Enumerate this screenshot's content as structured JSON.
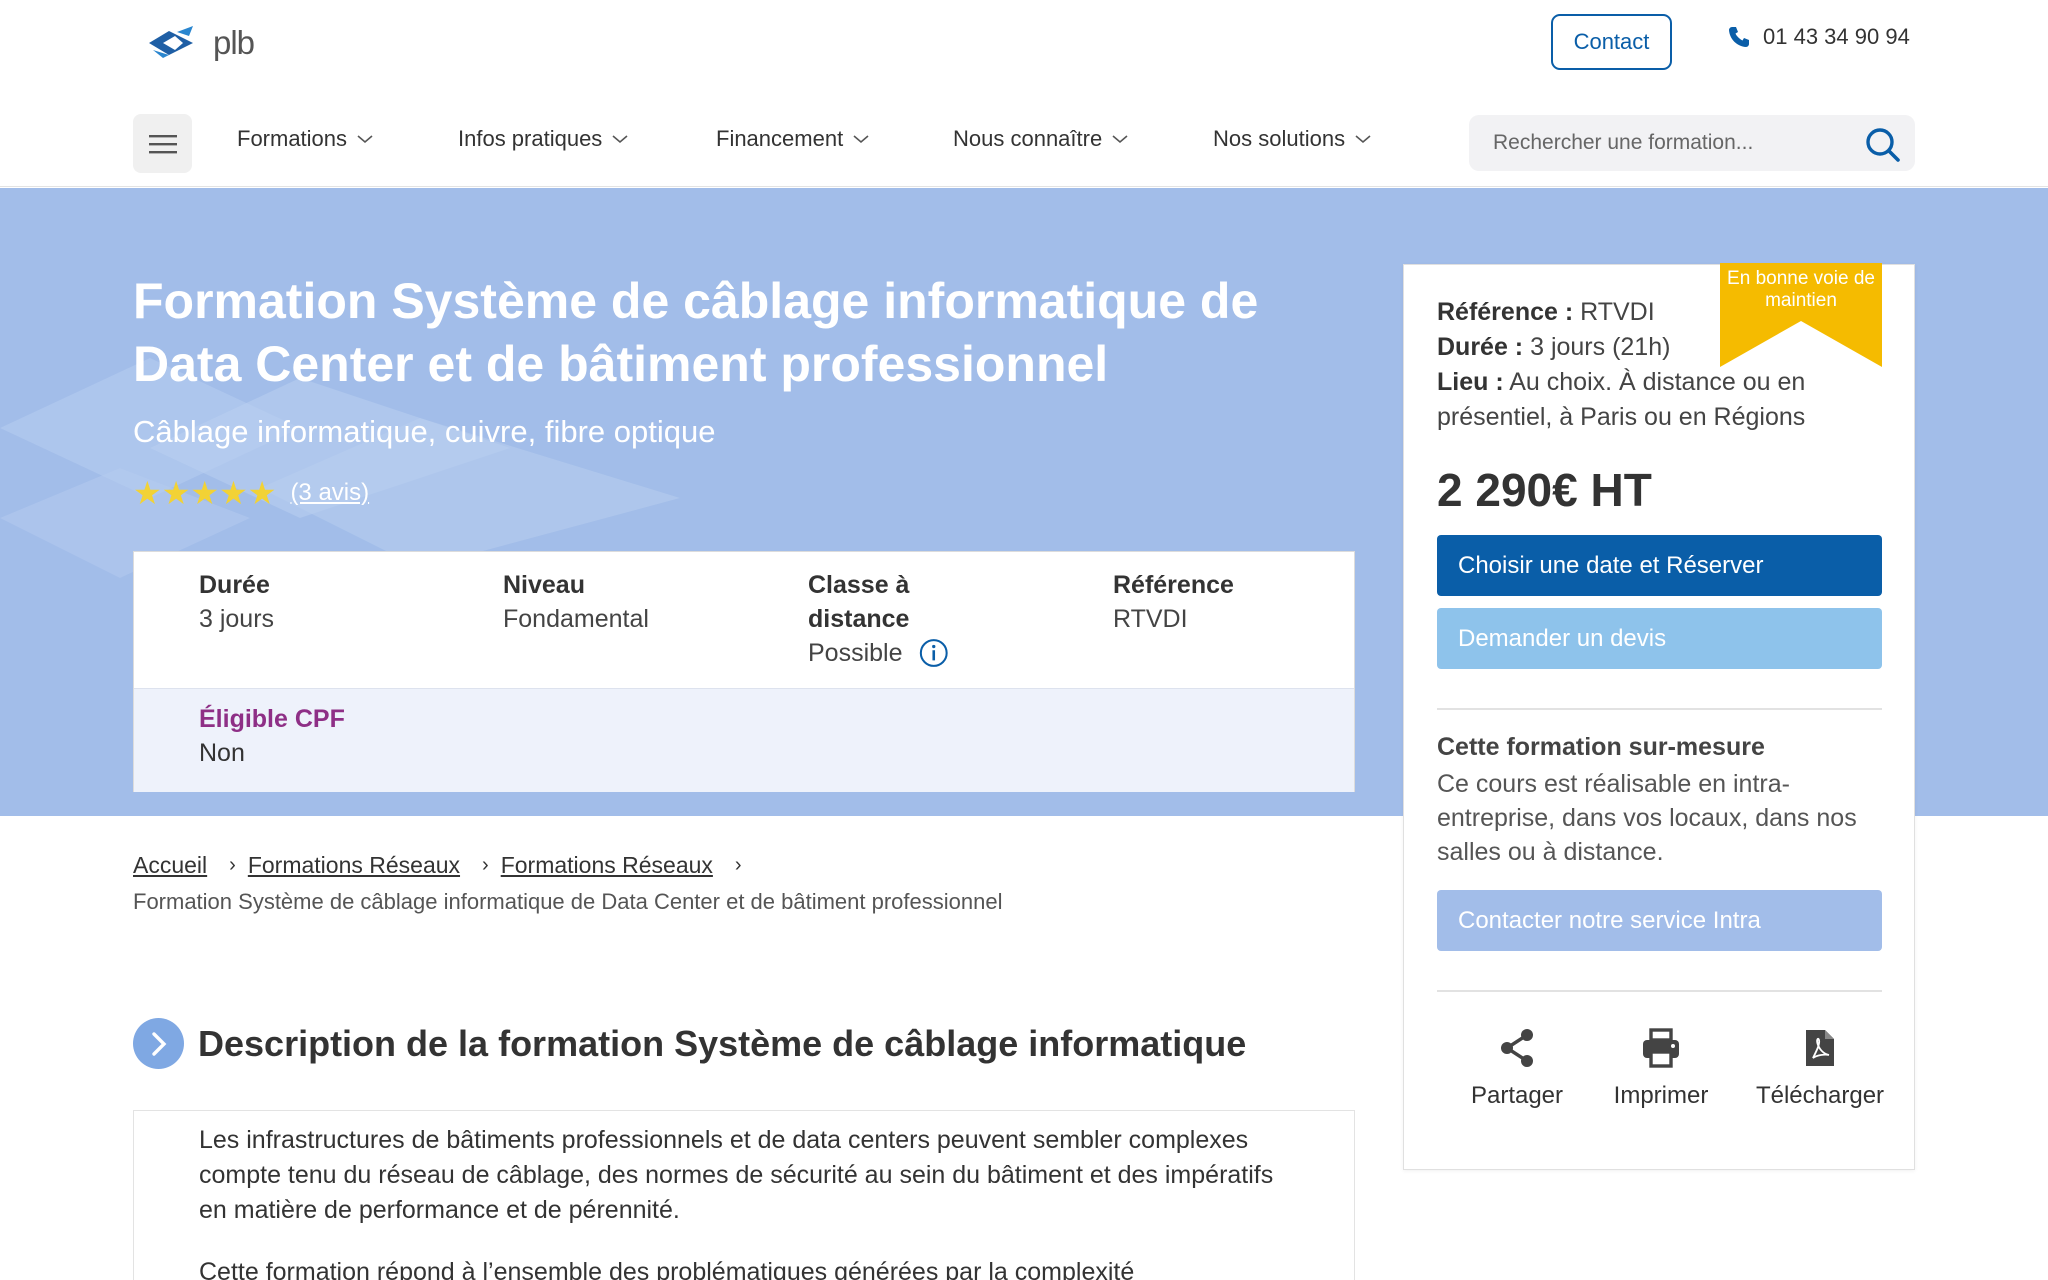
{
  "header": {
    "logo_text": "plb",
    "contact_label": "Contact",
    "phone": "01 43 34 90 94"
  },
  "nav": {
    "items": [
      {
        "label": "Formations"
      },
      {
        "label": "Infos pratiques"
      },
      {
        "label": "Financement"
      },
      {
        "label": "Nous connaître"
      },
      {
        "label": "Nos solutions"
      }
    ],
    "search_placeholder": "Rechercher une formation..."
  },
  "hero": {
    "title": "Formation Système de câblage informatique de Data Center et de bâtiment professionnel",
    "subtitle": "Câblage informatique, cuivre, fibre optique",
    "stars": "★★★★★",
    "rating": 4.8,
    "reviews_link": "(3 avis)"
  },
  "info": {
    "duration_label": "Durée",
    "duration_value": "3 jours",
    "level_label": "Niveau",
    "level_value": "Fondamental",
    "remote_label": "Classe à distance",
    "remote_value": "Possible",
    "reference_label": "Référence",
    "reference_value": "RTVDI",
    "cpf_label": "Éligible CPF",
    "cpf_value": "Non"
  },
  "card": {
    "ribbon": "En bonne voie de maintien",
    "ref_label": "Référence :",
    "ref_value": "RTVDI",
    "duration_label": "Durée :",
    "duration_value": "3 jours (21h)",
    "location_label": "Lieu :",
    "location_value": "Au choix. À distance ou en présentiel, à Paris ou en Régions",
    "price": "2 290€ HT",
    "book_label": "Choisir une date et Réserver",
    "quote_label": "Demander un devis",
    "custom_title": "Cette formation sur-mesure",
    "custom_text": "Ce cours est réalisable en intra-entreprise, dans vos locaux, dans nos salles ou à distance.",
    "intra_label": "Contacter notre service Intra",
    "share_label": "Partager",
    "print_label": "Imprimer",
    "download_label": "Télécharger"
  },
  "breadcrumb": {
    "items": [
      "Accueil",
      "Formations Réseaux",
      "Formations Réseaux"
    ],
    "separator": "›",
    "current": "Formation Système de câblage informatique de Data Center et de bâtiment professionnel"
  },
  "description": {
    "title": "Description de la formation Système de câblage informatique",
    "p1": "Les infrastructures de bâtiments professionnels et de data centers peuvent sembler complexes compte tenu du réseau de câblage, des normes de sécurité au sein du bâtiment et des impératifs en matière de performance et de pérennité.",
    "p2": "Cette formation répond à l’ensemble des problématiques générées par la complexité"
  },
  "colors": {
    "primary": "#0a5ea8",
    "hero_bg": "#a2bde9",
    "cpf": "#8e2f86",
    "ribbon": "#f5bb00",
    "stars": "#f2d235"
  }
}
